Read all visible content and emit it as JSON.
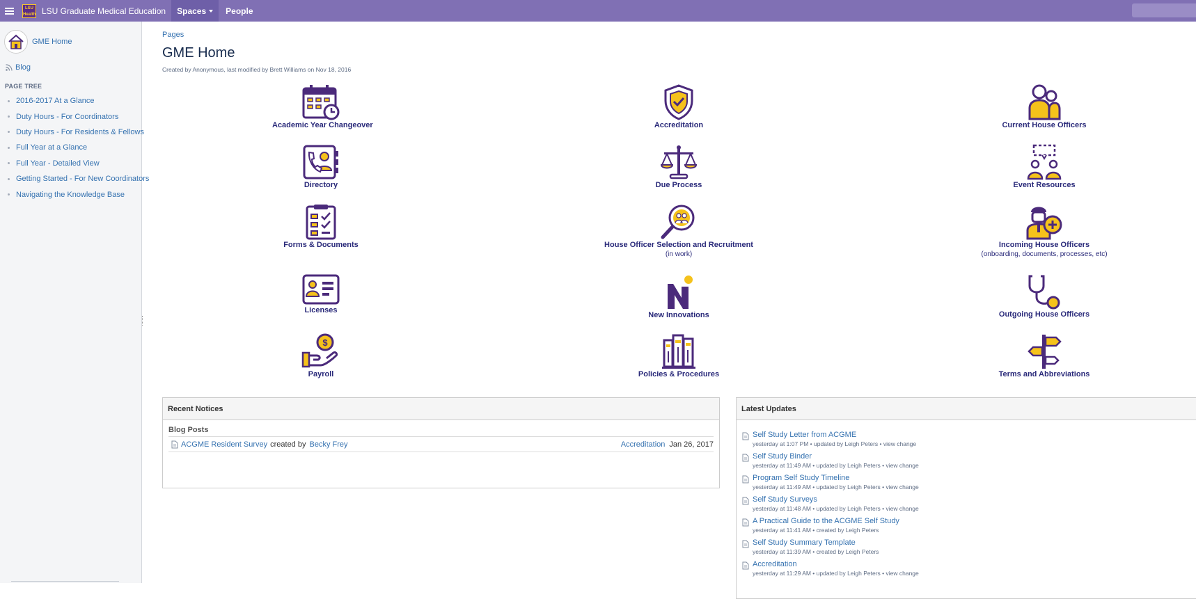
{
  "topbar": {
    "logo_text": "LSU Health",
    "app_name": "LSU Graduate Medical Education",
    "spaces_label": "Spaces",
    "people_label": "People"
  },
  "sidebar": {
    "space_name": "GME Home",
    "blog_label": "Blog",
    "page_tree_header": "PAGE TREE",
    "tree": [
      "2016-2017 At a Glance",
      "Duty Hours - For Coordinators",
      "Duty Hours - For Residents & Fellows",
      "Full Year at a Glance",
      "Full Year - Detailed View",
      "Getting Started - For New Coordinators",
      "Navigating the Knowledge Base"
    ]
  },
  "page": {
    "breadcrumb": "Pages",
    "title": "GME Home",
    "meta": "Created by Anonymous, last modified by Brett Williams on Nov 18, 2016"
  },
  "tiles": {
    "academic": {
      "label": "Academic Year Changeover",
      "icon": "calendar-clock-icon"
    },
    "accreditation": {
      "label": "Accreditation",
      "icon": "shield-check-icon"
    },
    "current_ho": {
      "label": "Current House Officers",
      "icon": "people-icon"
    },
    "directory": {
      "label": "Directory",
      "icon": "phone-book-icon"
    },
    "due_process": {
      "label": "Due Process",
      "icon": "scales-icon"
    },
    "event_resources": {
      "label": "Event Resources",
      "icon": "meeting-icon"
    },
    "forms": {
      "label": "Forms & Documents",
      "icon": "checklist-icon"
    },
    "recruitment": {
      "label": "House Officer Selection and Recruitment",
      "sub": "(in work)",
      "icon": "magnify-people-icon"
    },
    "incoming": {
      "label": "Incoming House Officers",
      "sub": "(onboarding, documents, processes, etc)",
      "icon": "doctor-plus-icon"
    },
    "licenses": {
      "label": "Licenses",
      "icon": "id-card-icon"
    },
    "new_innovations": {
      "label": "New Innovations",
      "icon": "ni-logo-icon"
    },
    "outgoing": {
      "label": "Outgoing House Officers",
      "icon": "stethoscope-icon"
    },
    "payroll": {
      "label": "Payroll",
      "icon": "hand-coin-icon"
    },
    "policies": {
      "label": "Policies & Procedures",
      "icon": "binders-icon"
    },
    "terms": {
      "label": "Terms and Abbreviations",
      "icon": "signpost-icon"
    }
  },
  "notices": {
    "title": "Recent Notices",
    "subheading": "Blog Posts",
    "post_title": "ACGME Resident Survey",
    "created_by": "created by",
    "author": "Becky Frey",
    "space": "Accreditation",
    "date": "Jan 26, 2017"
  },
  "updates": {
    "title": "Latest Updates",
    "items": [
      {
        "title": "Self Study Letter from ACGME",
        "meta": "yesterday at 1:07 PM • updated by Leigh Peters • view change"
      },
      {
        "title": "Self Study Binder",
        "meta": "yesterday at 11:49 AM • updated by Leigh Peters • view change"
      },
      {
        "title": "Program Self Study Timeline",
        "meta": "yesterday at 11:49 AM • updated by Leigh Peters • view change"
      },
      {
        "title": "Self Study Surveys",
        "meta": "yesterday at 11:48 AM • updated by Leigh Peters • view change"
      },
      {
        "title": "A Practical Guide to the ACGME Self Study",
        "meta": "yesterday at 11:41 AM • created by Leigh Peters"
      },
      {
        "title": "Self Study Summary Template",
        "meta": "yesterday at 11:39 AM • created by Leigh Peters"
      },
      {
        "title": "Accreditation",
        "meta": "yesterday at 11:29 AM • updated by Leigh Peters • view change"
      }
    ]
  },
  "colors": {
    "topbar": "#8070b4",
    "icon_purple": "#4b2a7b",
    "icon_gold": "#f5c21b",
    "link": "#3572b0"
  }
}
